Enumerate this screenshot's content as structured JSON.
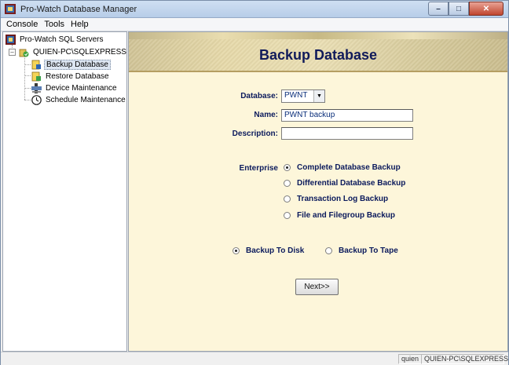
{
  "window": {
    "title": "Pro-Watch Database Manager"
  },
  "menu": [
    "Console",
    "Tools",
    "Help"
  ],
  "tree": {
    "root": "Pro-Watch SQL Servers",
    "server": "QUIEN-PC\\SQLEXPRESS",
    "items": [
      "Backup Database",
      "Restore Database",
      "Device Maintenance",
      "Schedule Maintenance"
    ],
    "selected": "Backup Database"
  },
  "main": {
    "title": "Backup Database",
    "database_label": "Database:",
    "database_value": "PWNT",
    "name_label": "Name:",
    "name_value": "PWNT backup",
    "description_label": "Description:",
    "description_value": "",
    "enterprise_label": "Enterprise",
    "backup_types": [
      {
        "label": "Complete Database Backup",
        "selected": true
      },
      {
        "label": "Differential Database Backup",
        "selected": false
      },
      {
        "label": "Transaction Log Backup",
        "selected": false
      },
      {
        "label": "File and Filegroup Backup",
        "selected": false
      }
    ],
    "targets": [
      {
        "label": "Backup To Disk",
        "selected": true
      },
      {
        "label": "Backup To Tape",
        "selected": false
      }
    ],
    "next_label": "Next>>"
  },
  "status": {
    "user": "quien",
    "server": "QUIEN-PC\\SQLEXPRESS"
  }
}
